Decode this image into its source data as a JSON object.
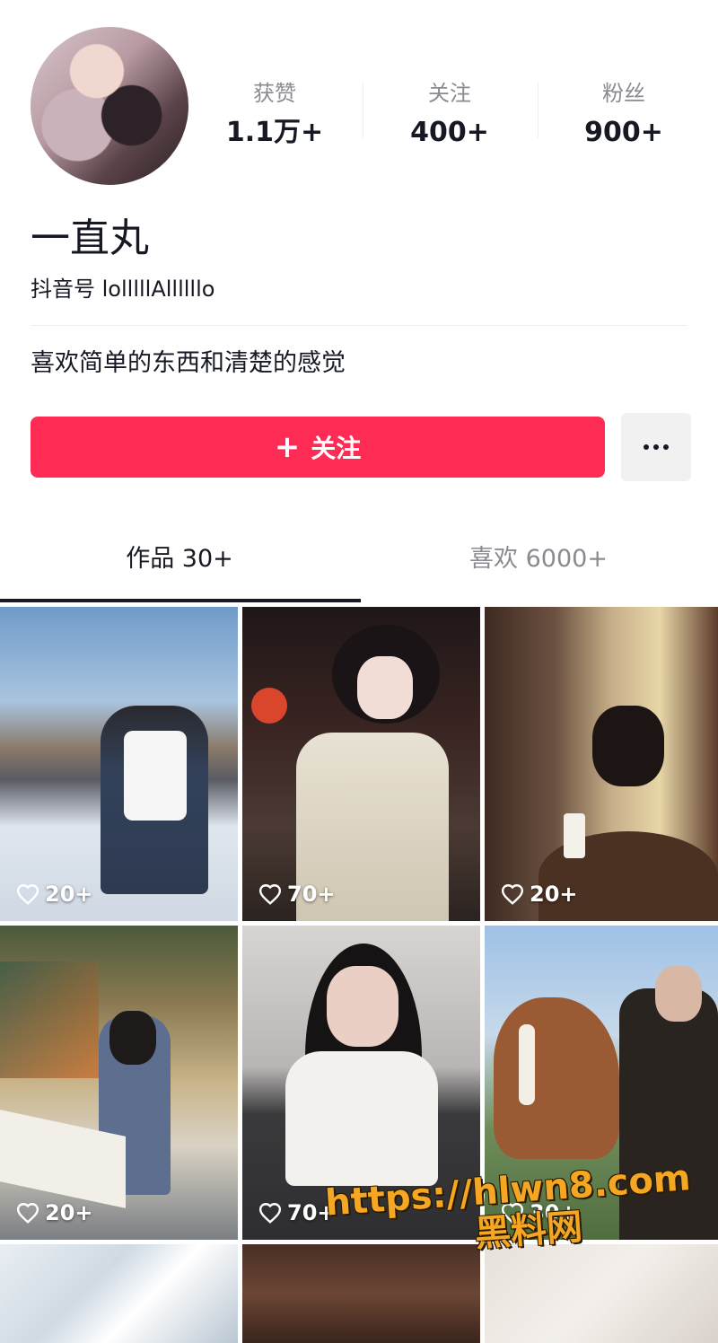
{
  "profile": {
    "stats": [
      {
        "label": "获赞",
        "value": "1.1万+"
      },
      {
        "label": "关注",
        "value": "400+"
      },
      {
        "label": "粉丝",
        "value": "900+"
      }
    ],
    "name": "一直丸",
    "account_id": "抖音号 lolllllAllllllo",
    "bio": "喜欢简单的东西和清楚的感觉"
  },
  "actions": {
    "follow_icon": "+",
    "follow_label": "关注",
    "more_icon": "more-dots-icon"
  },
  "tabs": [
    {
      "label": "作品 30+",
      "active": true
    },
    {
      "label": "喜欢 6000+",
      "active": false
    }
  ],
  "videos": [
    {
      "likes": "20+"
    },
    {
      "likes": "70+"
    },
    {
      "likes": "20+"
    },
    {
      "likes": "20+"
    },
    {
      "likes": "70+"
    },
    {
      "likes": "30+"
    }
  ],
  "watermark": {
    "line1": "https://hlwn8.com",
    "line2": "黑料网"
  },
  "colors": {
    "accent": "#fe2c55",
    "text": "#161823",
    "secondary_text": "#8a8b91"
  }
}
